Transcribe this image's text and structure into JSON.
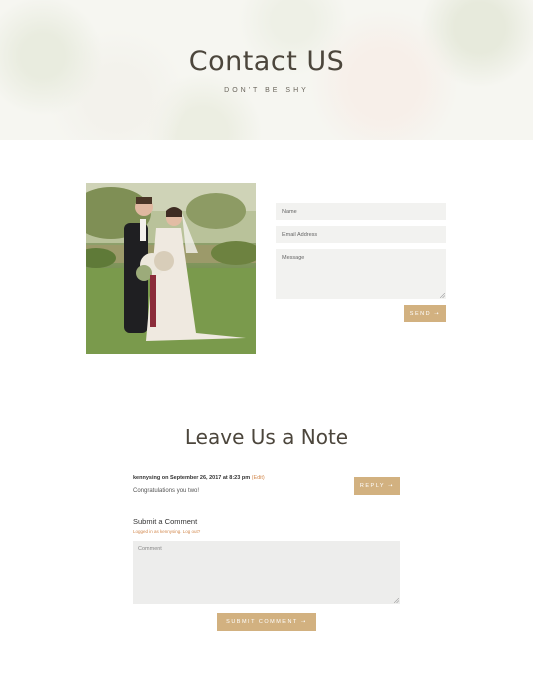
{
  "hero": {
    "title": "Contact US",
    "subtitle": "DON'T BE SHY"
  },
  "contact_form": {
    "name_placeholder": "Name",
    "email_placeholder": "Email Address",
    "message_placeholder": "Message",
    "send_label": "SEND ➝"
  },
  "note_section": {
    "title": "Leave Us a Note",
    "comment": {
      "author": "kennysing",
      "date_text": "on September 26, 2017 at 8:23 pm",
      "edit_label": "(Edit)",
      "body": "Congratulations you two!",
      "reply_label": "REPLY ➝"
    },
    "submit_heading": "Submit a Comment",
    "logged_in_text": "Logged in as kennysing. Log out?",
    "comment_placeholder": "Comment",
    "submit_label": "SUBMIT COMMENT ➝"
  },
  "colors": {
    "accent": "#d2b180",
    "link": "#d2894e",
    "heading": "#4c463c"
  },
  "icons": [
    "resize-grip-icon"
  ]
}
